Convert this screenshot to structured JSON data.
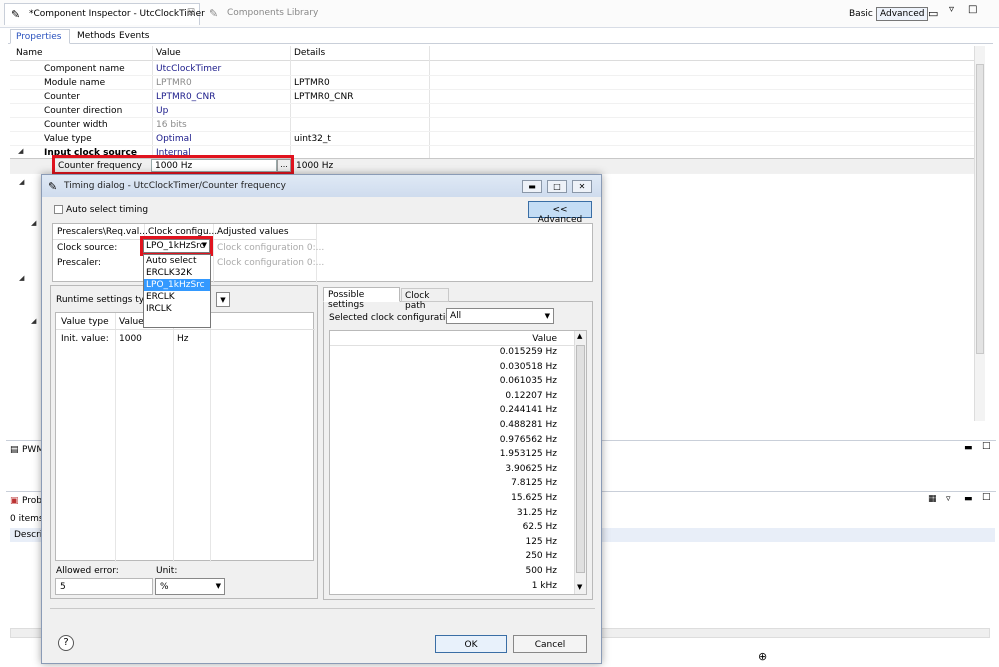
{
  "editor": {
    "tabs": [
      {
        "label": "*Component Inspector - UtcClockTimer",
        "close": "☒"
      },
      {
        "label": "Components Library"
      }
    ],
    "mode_basic": "Basic",
    "mode_advanced": "Advanced",
    "subtabs": [
      "Properties",
      "Methods",
      "Events"
    ],
    "columns": [
      "Name",
      "Value",
      "Details"
    ],
    "rows": [
      {
        "name": "Component name",
        "value": "UtcClockTimer",
        "details": ""
      },
      {
        "name": "Module name",
        "value": "LPTMR0",
        "details": "LPTMR0"
      },
      {
        "name": "Counter",
        "value": "LPTMR0_CNR",
        "details": "LPTMR0_CNR"
      },
      {
        "name": "Counter direction",
        "value": "Up",
        "details": ""
      },
      {
        "name": "Counter width",
        "value": "16 bits",
        "details": ""
      },
      {
        "name": "Value type",
        "value": "Optimal",
        "details": "uint32_t"
      },
      {
        "name": "Input clock source",
        "value": "Internal",
        "details": ""
      },
      {
        "name": "Counter frequency",
        "value": "1000 Hz",
        "details": "1000 Hz",
        "button": "..."
      }
    ]
  },
  "panels": {
    "pwm_label": "PWM",
    "problems_label": "Probl",
    "problems_count": "0 items",
    "problems_column": "Descri"
  },
  "dialog": {
    "title": "Timing dialog - UtcClockTimer/Counter frequency",
    "auto_select_label": "Auto select timing",
    "advanced_button": "<< Advanced",
    "prescaler_headers": [
      "Prescalers\\Req.val...",
      "Clock configu...",
      "Adjusted values"
    ],
    "clock_source_label": "Clock source:",
    "clock_source_value": "LPO_1kHzSrc",
    "clock_source_adjusted": "Clock configuration 0:...",
    "prescaler_label": "Prescaler:",
    "prescaler_adjusted": "Clock configuration 0:...",
    "clock_source_options": [
      "Auto select",
      "ERCLK32K",
      "LPO_1kHzSrc",
      "ERCLK",
      "IRCLK"
    ],
    "clock_source_selected_index": 2,
    "runtime_label": "Runtime settings type",
    "runtime_headers": [
      "Value type",
      "Value"
    ],
    "runtime_row": {
      "type": "Init. value:",
      "value": "1000",
      "unit": "Hz"
    },
    "allowed_error_label": "Allowed error:",
    "allowed_error_value": "5",
    "unit_label": "Unit:",
    "unit_value": "%",
    "tabs": [
      "Possible settings",
      "Clock path"
    ],
    "selected_clock_config_label": "Selected clock configuration",
    "selected_clock_config_value": "All",
    "values_header": "Value",
    "values": [
      "0.015259 Hz",
      "0.030518 Hz",
      "0.061035 Hz",
      "0.12207 Hz",
      "0.244141 Hz",
      "0.488281 Hz",
      "0.976562 Hz",
      "1.953125 Hz",
      "3.90625 Hz",
      "7.8125 Hz",
      "15.625 Hz",
      "31.25 Hz",
      "62.5 Hz",
      "125 Hz",
      "250 Hz",
      "500 Hz",
      "1 kHz"
    ],
    "ok_label": "OK",
    "cancel_label": "Cancel",
    "help_symbol": "?"
  },
  "colors": {
    "highlight": "#e0131e",
    "link": "#1a1a8a",
    "selection": "#3399ff"
  }
}
